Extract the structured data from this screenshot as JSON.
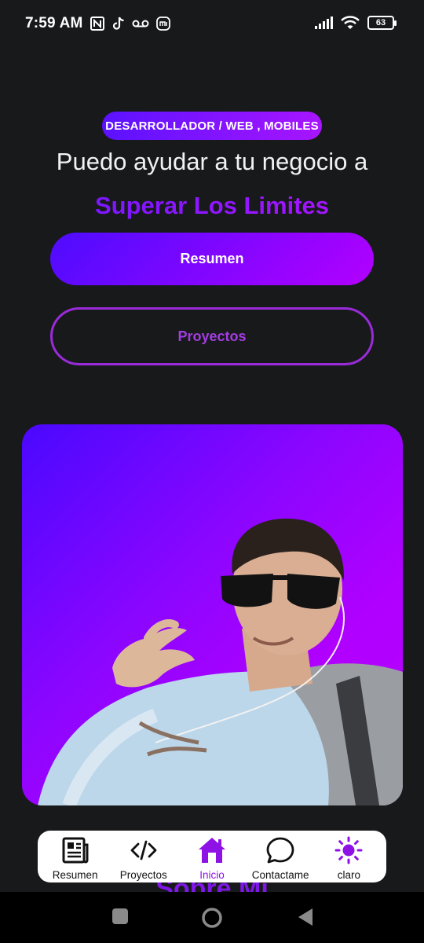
{
  "status_bar": {
    "time": "7:59 AM",
    "left_icons": [
      "nfc-icon",
      "tiktok-icon",
      "voicemail-icon",
      "mi-icon"
    ],
    "right_icons": [
      "signal-icon",
      "wifi-icon"
    ],
    "battery": "63"
  },
  "hero": {
    "badge": "DESARROLLADOR / WEB , MOBILES",
    "title": "Puedo ayudar a tu negocio a",
    "highlight": "Superar Los Limites",
    "primary_button": "Resumen",
    "secondary_button": "Proyectos"
  },
  "photo": {
    "description_icon": "profile-photo",
    "accent_start": "#4a08ff",
    "accent_end": "#b800ff"
  },
  "section_peek": "Sobre Mi",
  "bottom_nav": {
    "items": [
      {
        "label": "Resumen",
        "icon": "newspaper-icon"
      },
      {
        "label": "Proyectos",
        "icon": "code-icon"
      },
      {
        "label": "Inicio",
        "icon": "home-icon",
        "active": true
      },
      {
        "label": "Contactame",
        "icon": "chat-bubble-icon"
      },
      {
        "label": "claro",
        "icon": "sun-icon"
      }
    ],
    "active_color": "#8e12e6"
  },
  "system_nav": [
    "recents-button",
    "home-button",
    "back-button"
  ]
}
